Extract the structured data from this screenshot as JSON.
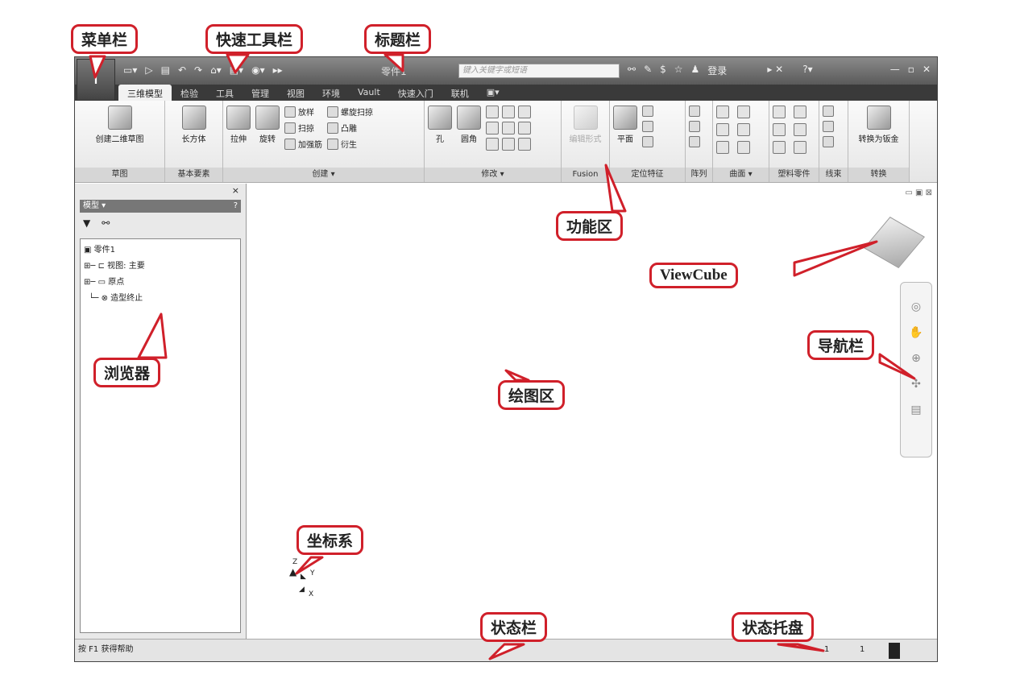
{
  "window": {
    "app_icon": "I",
    "qat": [
      "▭▾",
      "▷",
      "▤",
      "↶",
      "↷",
      "⌂▾",
      "▤▾",
      "◉▾",
      "▸▸"
    ],
    "title": "零件1",
    "search_placeholder": "键入关键字或短语",
    "right_icons": [
      "⚯",
      "✎",
      "$",
      "☆",
      "♟"
    ],
    "login": "登录",
    "right_extra": "▸ ✕",
    "help": "?▾",
    "window_controls": [
      "—",
      "▫",
      "✕"
    ]
  },
  "tabs": [
    "三维模型",
    "检验",
    "工具",
    "管理",
    "视图",
    "环境",
    "Vault",
    "快速入门",
    "联机",
    "▣▾"
  ],
  "ribbon": {
    "sketch": {
      "button": "创建二维草图",
      "title": "草图"
    },
    "primitives": {
      "button": "长方体",
      "title": "基本要素"
    },
    "create": {
      "extrude": "拉伸",
      "revolve": "旋转",
      "loft": "放样",
      "sweep": "扫掠",
      "rib": "加强筋",
      "coil": "螺旋扫掠",
      "emboss": "凸雕",
      "derive": "衍生",
      "title": "创建 ▾"
    },
    "modify": {
      "hole": "孔",
      "fillet": "圆角",
      "title": "修改 ▾"
    },
    "fusion": {
      "button": "编辑形式",
      "title": "Fusion"
    },
    "work": {
      "plane": "平面",
      "title": "定位特征"
    },
    "pattern": {
      "title": "阵列"
    },
    "surface": {
      "title": "曲面 ▾"
    },
    "plastic": {
      "title": "塑料零件"
    },
    "harness": {
      "title": "线束"
    },
    "convert": {
      "button": "转换为钣金",
      "title": "转换"
    }
  },
  "browser": {
    "header": "模型 ▾",
    "help": "?",
    "close": "×",
    "items": [
      "零件1",
      "视图: 主要",
      "原点",
      "造型终止"
    ]
  },
  "status": {
    "help_text": "按 F1 获得帮助",
    "tray": [
      "1",
      "1"
    ]
  },
  "canvas": {
    "controls": "▭ ▣ ⊠",
    "axes": {
      "x": "X",
      "y": "Y",
      "z": "Z"
    }
  },
  "callouts": {
    "menu": "菜单栏",
    "qat": "快速工具栏",
    "title": "标题栏",
    "ribbon": "功能区",
    "viewcube": "ViewCube",
    "navbar": "导航栏",
    "browser": "浏览器",
    "canvas": "绘图区",
    "ucs": "坐标系",
    "statusbar": "状态栏",
    "tray": "状态托盘"
  }
}
